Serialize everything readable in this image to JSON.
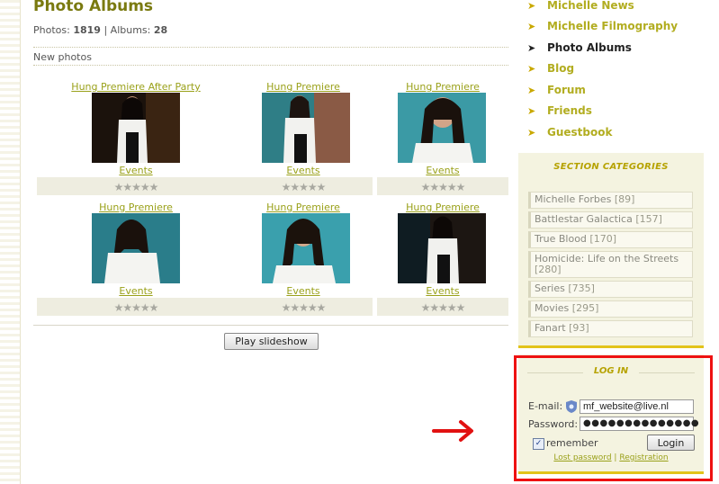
{
  "page": {
    "title": "Photo Albums",
    "stats": {
      "photos_label": "Photos:",
      "photos_count": "1819",
      "divider": "|",
      "albums_label": "Albums:",
      "albums_count": "28"
    },
    "section_label": "New photos"
  },
  "photos": [
    {
      "title": "Hung Premiere After Party",
      "category": "Events",
      "stars": "★★★★★"
    },
    {
      "title": "Hung Premiere",
      "category": "Events",
      "stars": "★★★★★"
    },
    {
      "title": "Hung Premiere",
      "category": "Events",
      "stars": "★★★★★"
    },
    {
      "title": "Hung Premiere",
      "category": "Events",
      "stars": "★★★★★"
    },
    {
      "title": "Hung Premiere",
      "category": "Events",
      "stars": "★★★★★"
    },
    {
      "title": "Hung Premiere",
      "category": "Events",
      "stars": "★★★★★"
    }
  ],
  "slideshow_button": "Play slideshow",
  "sidebar": {
    "nav": [
      {
        "label": "Michelle News",
        "active": false
      },
      {
        "label": "Michelle Filmography",
        "active": false
      },
      {
        "label": "Photo Albums",
        "active": true
      },
      {
        "label": "Blog",
        "active": false
      },
      {
        "label": "Forum",
        "active": false
      },
      {
        "label": "Friends",
        "active": false
      },
      {
        "label": "Guestbook",
        "active": false
      }
    ],
    "categories_heading": "SECTION CATEGORIES",
    "categories": [
      {
        "name": "Michelle Forbes",
        "count": "[89]"
      },
      {
        "name": "Battlestar Galactica",
        "count": "[157]"
      },
      {
        "name": "True Blood",
        "count": "[170]"
      },
      {
        "name": "Homicide: Life on the Streets",
        "count": "[280]"
      },
      {
        "name": "Series",
        "count": "[735]"
      },
      {
        "name": "Movies",
        "count": "[295]"
      },
      {
        "name": "Fanart",
        "count": "[93]"
      }
    ]
  },
  "login": {
    "heading": "LOG IN",
    "email_label": "E-mail:",
    "email_value": "mf_website@live.nl",
    "password_label": "Password:",
    "password_value": "●●●●●●●●●●●●●●",
    "remember_label": "remember",
    "remember_checked": "✓",
    "login_button": "Login",
    "lost_password": "Lost password",
    "link_divider": "|",
    "registration": "Registration"
  },
  "colors": {
    "accent_olive": "#7a7a10",
    "link_green": "#9aa11a",
    "gold": "#e2c31a",
    "annotation_red": "#e11111"
  }
}
